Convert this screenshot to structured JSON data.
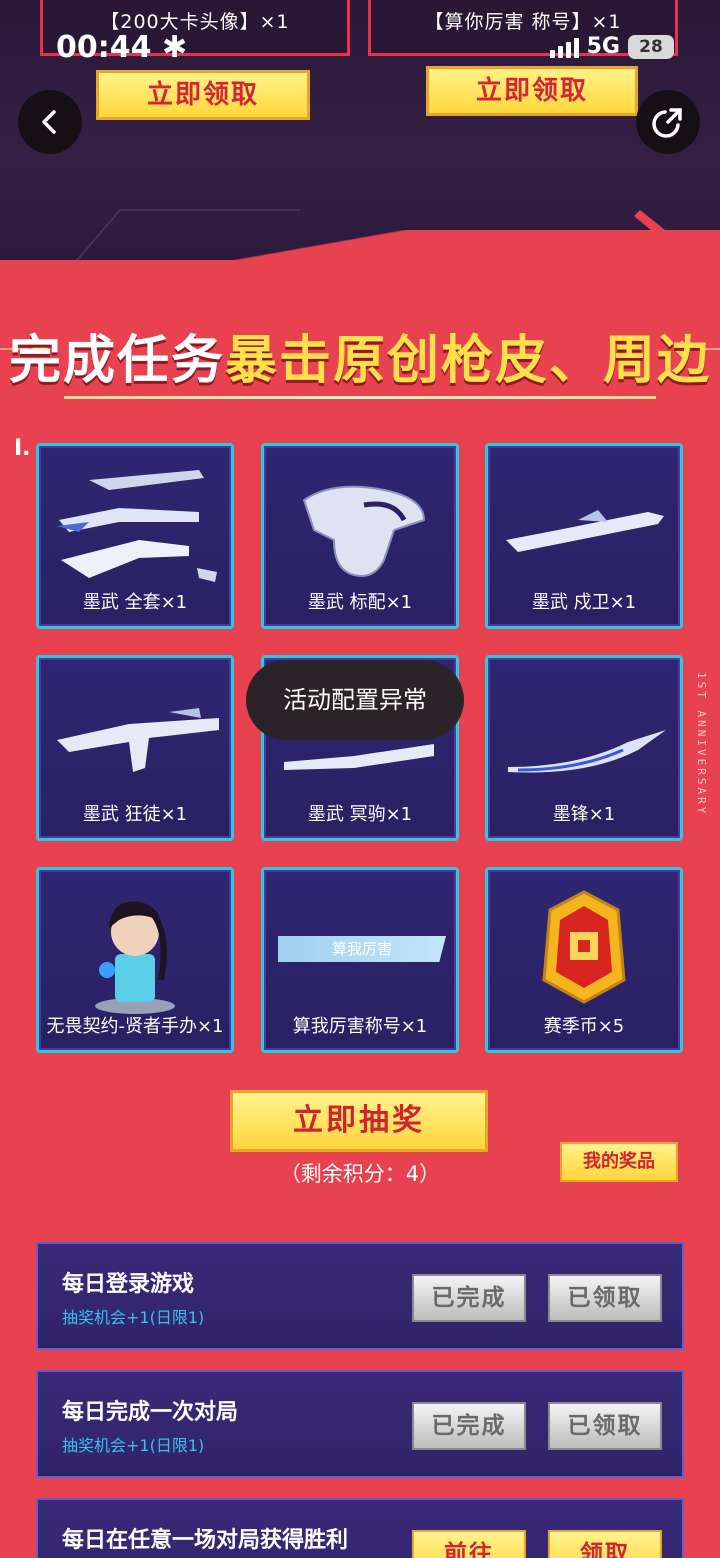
{
  "status_bar": {
    "time": "00:44",
    "network": "5G",
    "battery": "28"
  },
  "top_rewards": {
    "left_label": "【200大卡头像】×1",
    "right_label": "【算你厉害 称号】×1",
    "claim_label": "立即领取"
  },
  "heading": {
    "part1": "完成任务",
    "part2": "暴击原创枪皮、周边"
  },
  "prizes": [
    {
      "label": "墨武 全套×1",
      "art": "weapon-set-icon"
    },
    {
      "label": "墨武 标配×1",
      "art": "pistol-icon"
    },
    {
      "label": "墨武 戍卫×1",
      "art": "rifle-icon"
    },
    {
      "label": "墨武 狂徒×1",
      "art": "rifle-icon"
    },
    {
      "label": "墨武 冥驹×1",
      "art": "rifle-icon"
    },
    {
      "label": "墨锋×1",
      "art": "blade-icon"
    },
    {
      "label": "无畏契约-贤者手办×1",
      "art": "figure-icon"
    },
    {
      "label": "算我厉害称号×1",
      "art": "title-tag-icon",
      "tag": "算我厉害"
    },
    {
      "label": "赛季币×5",
      "art": "coin-icon"
    }
  ],
  "toast": "活动配置异常",
  "draw": {
    "button": "立即抽奖",
    "points": "（剩余积分：4）",
    "my_prizes": "我的奖品"
  },
  "tasks": [
    {
      "title": "每日登录游戏",
      "subtitle": "抽奖机会+1(日限1)",
      "btn1": "已完成",
      "btn2": "已领取"
    },
    {
      "title": "每日完成一次对局",
      "subtitle": "抽奖机会+1(日限1)",
      "btn1": "已完成",
      "btn2": "已领取"
    },
    {
      "title": "每日在任意一场对局获得胜利",
      "subtitle": "",
      "btn1": "前往",
      "btn2": "领取"
    }
  ],
  "decor": {
    "side_text": "1ST ANNIVERSARY",
    "roman": "I."
  },
  "colors": {
    "bg_red": "#e84150",
    "gold": "#ffd53b",
    "card_blue": "#2f2772",
    "cyan": "#2ec8e0"
  }
}
